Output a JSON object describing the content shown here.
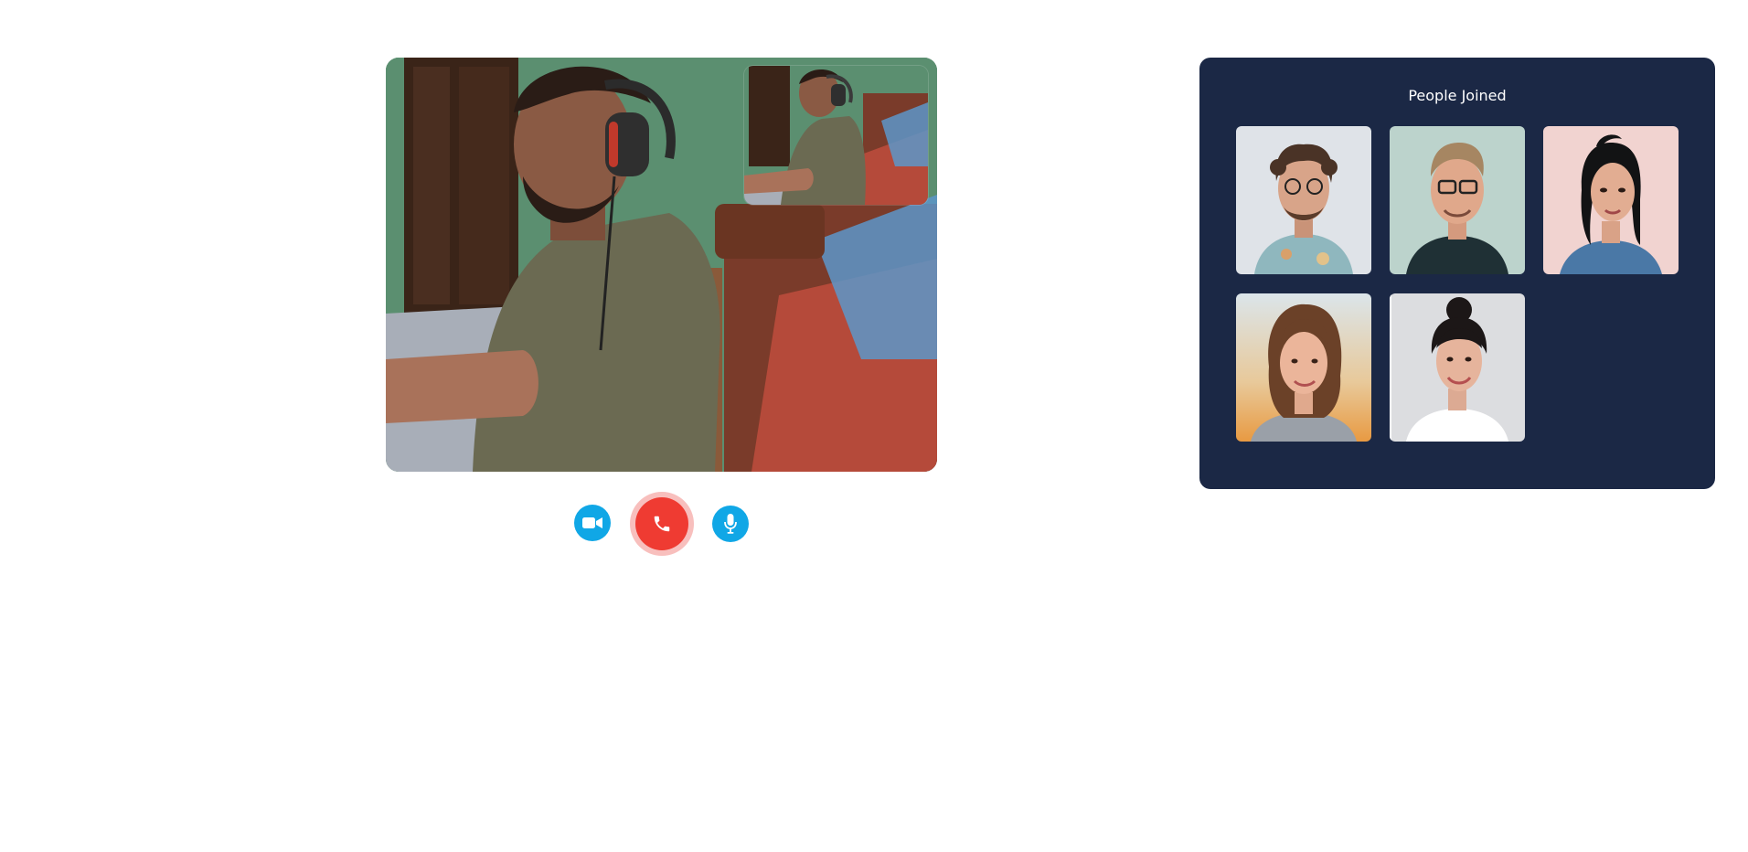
{
  "main_video": {
    "participant": "main-participant",
    "self_view_label": "self-view"
  },
  "controls": {
    "camera_icon": "video-camera-icon",
    "hangup_icon": "phone-icon",
    "mic_icon": "microphone-icon",
    "accent_color": "#10a7e6",
    "hangup_color": "#ef3b32"
  },
  "people_panel": {
    "title": "People Joined",
    "background": "#1b2845",
    "participants": [
      {
        "icon": "avatar-curly-hair-glasses"
      },
      {
        "icon": "avatar-short-hair-glasses"
      },
      {
        "icon": "avatar-dark-hair-bun"
      },
      {
        "icon": "avatar-wavy-hair"
      },
      {
        "icon": "avatar-hair-bun-white-top"
      }
    ]
  }
}
